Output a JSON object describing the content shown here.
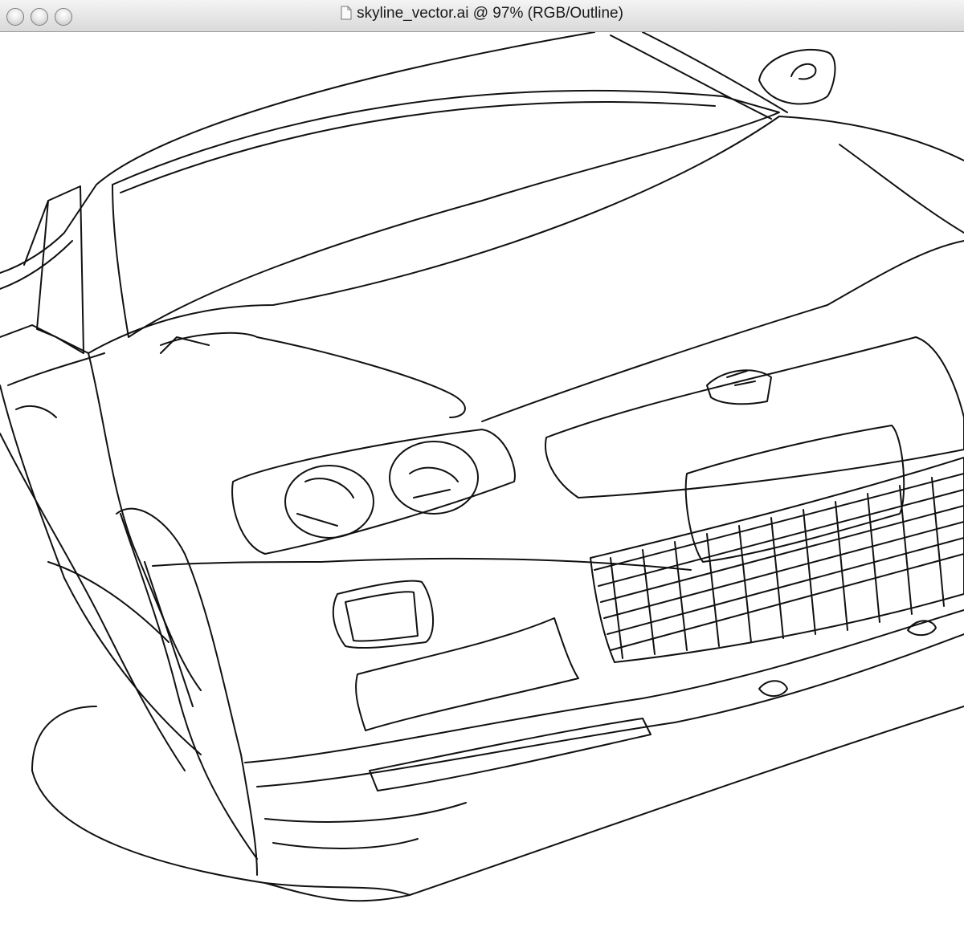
{
  "window": {
    "title": "skyline_vector.ai @ 97% (RGB/Outline)",
    "controls": [
      "close",
      "minimize",
      "zoom"
    ]
  },
  "document": {
    "filename": "skyline_vector.ai",
    "zoom": "97%",
    "color_mode": "RGB",
    "view_mode": "Outline"
  },
  "artwork": {
    "subject_icon": "car-front-outline-icon"
  }
}
